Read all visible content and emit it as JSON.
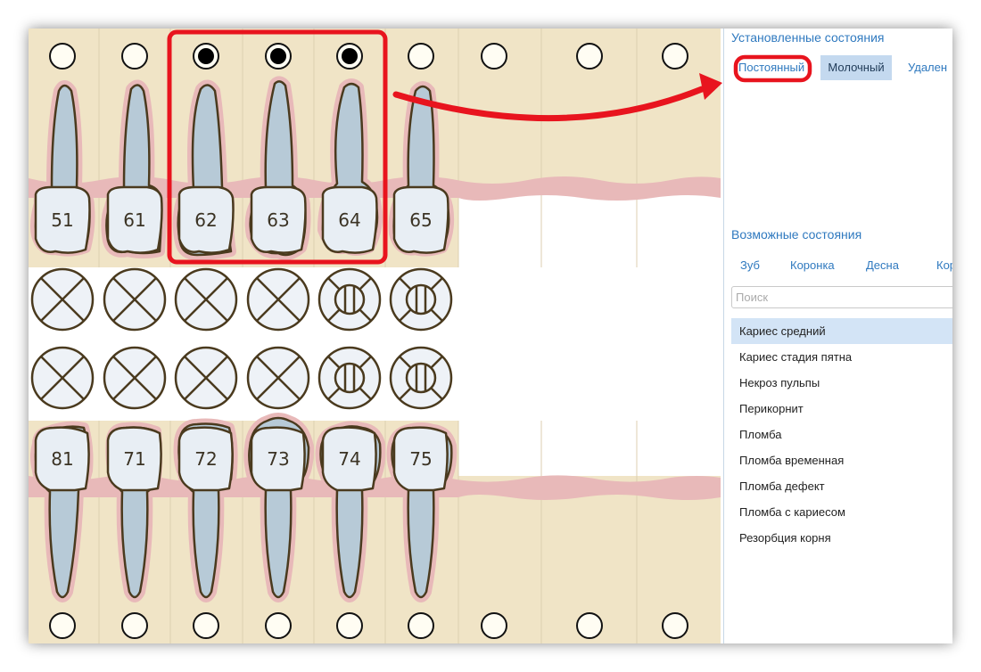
{
  "colors": {
    "row_background": "#f0e4c6",
    "column_divider": "#dccfb0",
    "gum": "#e8b9b9",
    "root_fill": "#b7cad7",
    "crown_fill": "#e8eef4",
    "outline": "#4a3a1e",
    "annotation_red": "#e8141e",
    "link_blue": "#2f79bf",
    "selected_chip": "#c4d9ef",
    "selected_row": "#d3e4f6"
  },
  "tooth_chart": {
    "upper_teeth": [
      {
        "number": "51",
        "marker": "empty-circle",
        "symbol": "cross-circle"
      },
      {
        "number": "61",
        "marker": "empty-circle",
        "symbol": "cross-circle"
      },
      {
        "number": "62",
        "marker": "filled-dot-circle",
        "symbol": "cross-circle"
      },
      {
        "number": "63",
        "marker": "filled-dot-circle",
        "symbol": "cross-circle"
      },
      {
        "number": "64",
        "marker": "filled-dot-circle",
        "symbol": "tooth-surfaces-circle"
      },
      {
        "number": "65",
        "marker": "empty-circle",
        "symbol": "tooth-surfaces-circle"
      },
      {
        "number": "",
        "marker": "empty-circle",
        "symbol": ""
      },
      {
        "number": "",
        "marker": "empty-circle",
        "symbol": ""
      },
      {
        "number": "",
        "marker": "empty-circle",
        "symbol": ""
      }
    ],
    "lower_teeth": [
      {
        "number": "81",
        "marker": "empty-circle",
        "symbol": "cross-circle"
      },
      {
        "number": "71",
        "marker": "empty-circle",
        "symbol": "cross-circle"
      },
      {
        "number": "72",
        "marker": "empty-circle",
        "symbol": "cross-circle"
      },
      {
        "number": "73",
        "marker": "empty-circle",
        "symbol": "cross-circle"
      },
      {
        "number": "74",
        "marker": "empty-circle",
        "symbol": "tooth-surfaces-circle"
      },
      {
        "number": "75",
        "marker": "empty-circle",
        "symbol": "tooth-surfaces-circle"
      },
      {
        "number": "",
        "marker": "empty-circle",
        "symbol": ""
      },
      {
        "number": "",
        "marker": "empty-circle",
        "symbol": ""
      },
      {
        "number": "",
        "marker": "empty-circle",
        "symbol": ""
      }
    ],
    "highlighted_teeth": [
      "62",
      "63",
      "64"
    ]
  },
  "panel": {
    "installed_title": "Установленные состояния",
    "installed_chips": [
      {
        "label": "Постоянный",
        "selected": false,
        "annotated": true
      },
      {
        "label": "Молочный",
        "selected": true,
        "annotated": false
      },
      {
        "label": "Удален",
        "selected": false,
        "annotated": false
      }
    ],
    "possible_title": "Возможные состояния",
    "category_tabs": [
      "Зуб",
      "Коронка",
      "Десна",
      "Кор"
    ],
    "search_placeholder": "Поиск",
    "search_value": "",
    "states": [
      {
        "label": "Кариес средний",
        "selected": true
      },
      {
        "label": "Кариес стадия пятна",
        "selected": false
      },
      {
        "label": "Некроз пульпы",
        "selected": false
      },
      {
        "label": "Перикорнит",
        "selected": false
      },
      {
        "label": "Пломба",
        "selected": false
      },
      {
        "label": "Пломба временная",
        "selected": false
      },
      {
        "label": "Пломба дефект",
        "selected": false
      },
      {
        "label": "Пломба с кариесом",
        "selected": false
      },
      {
        "label": "Резорбция корня",
        "selected": false
      }
    ]
  }
}
